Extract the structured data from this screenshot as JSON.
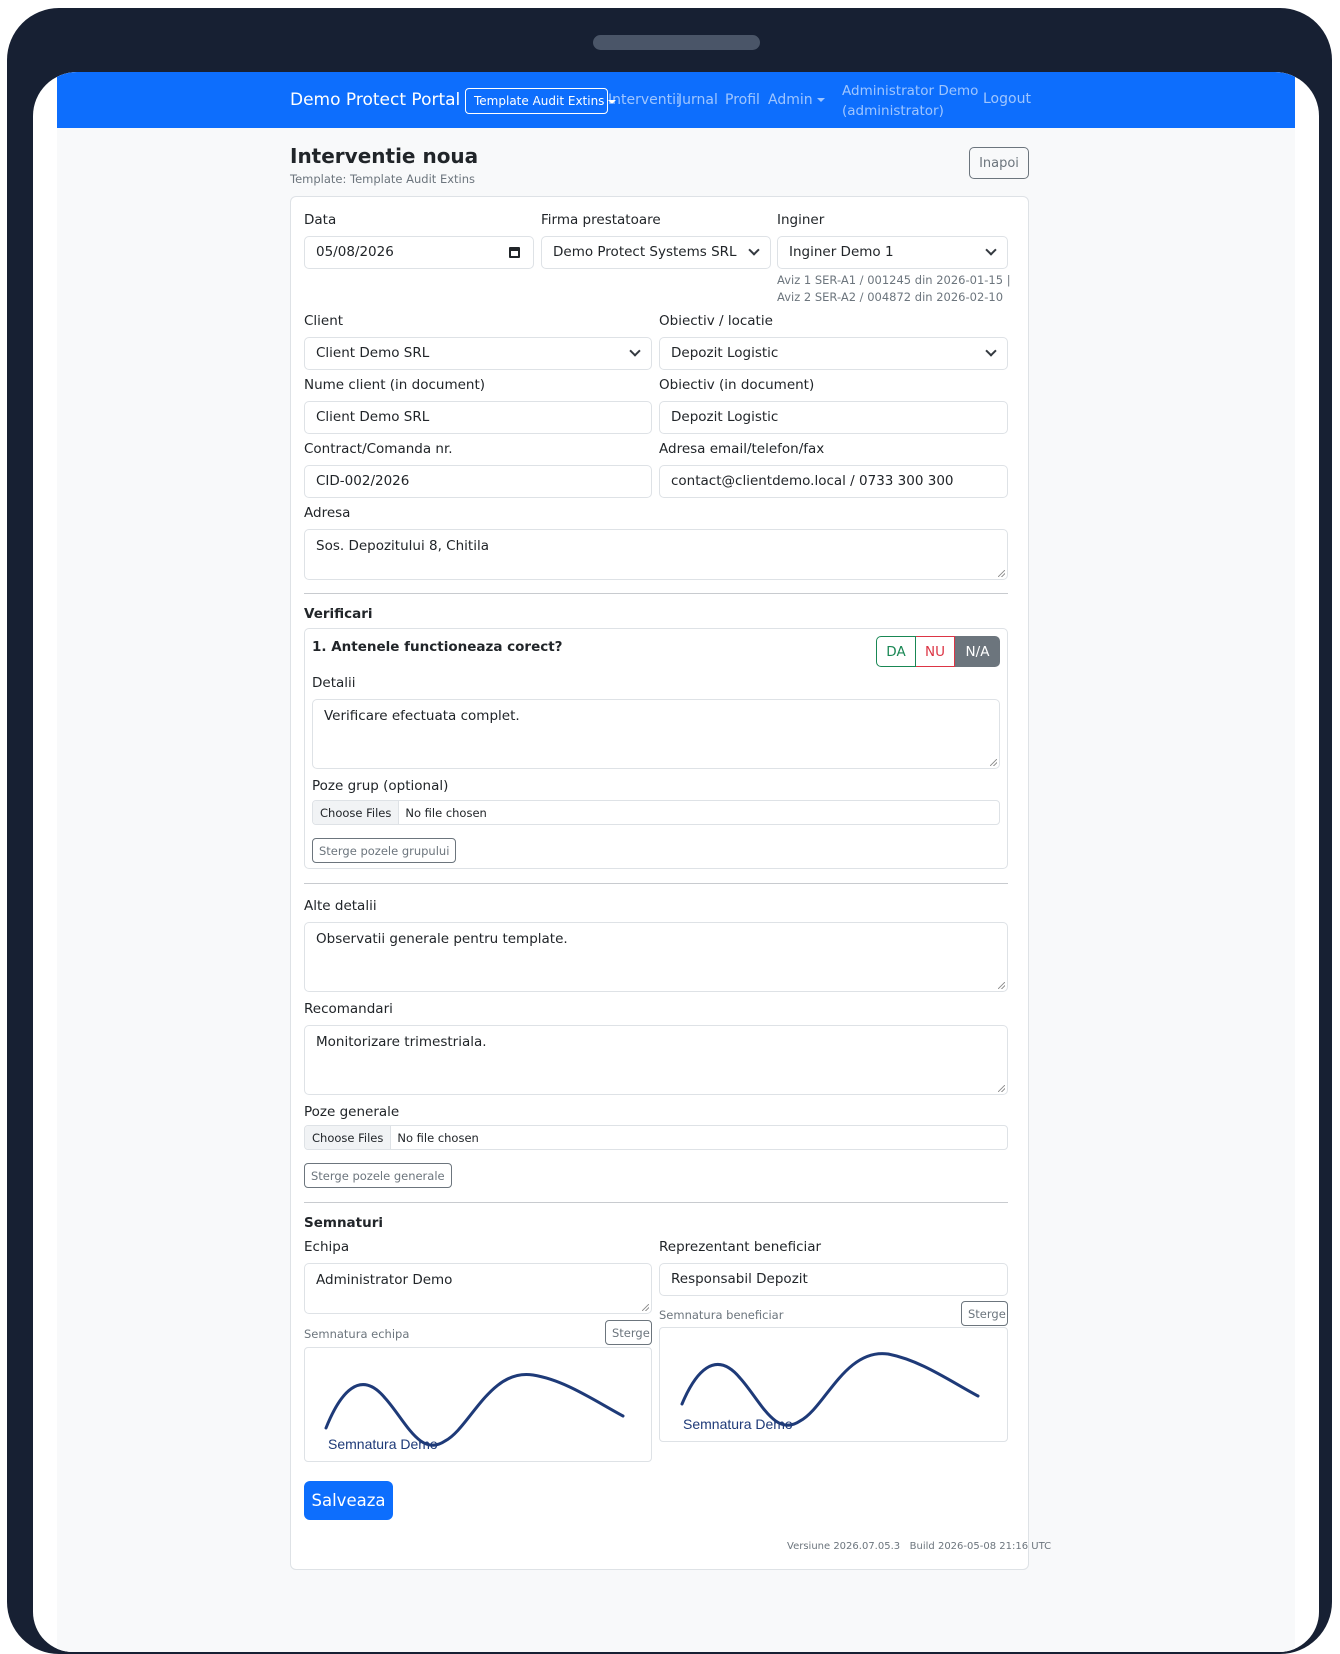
{
  "navbar": {
    "brand": "Demo Protect Portal",
    "template_dropdown": "Template Audit Extins",
    "links": [
      "Interventii",
      "Jurnal",
      "Profil",
      "Admin"
    ],
    "user_name": "Administrator Demo",
    "user_role": "(administrator)",
    "logout": "Logout"
  },
  "header": {
    "title": "Interventie noua",
    "subtitle": "Template: Template Audit Extins",
    "back_button": "Inapoi"
  },
  "form": {
    "data_label": "Data",
    "data_value": "05/08/2026",
    "firma_label": "Firma prestatoare",
    "firma_value": "Demo Protect Systems SRL",
    "inginer_label": "Inginer",
    "inginer_value": "Inginer Demo 1",
    "inginer_hint": "Aviz 1 SER-A1 / 001245 din 2026-01-15 | Aviz 2 SER-A2 / 004872 din 2026-02-10",
    "client_label": "Client",
    "client_value": "Client Demo SRL",
    "obiectiv_label": "Obiectiv / locatie",
    "obiectiv_value": "Depozit Logistic",
    "nume_client_label": "Nume client (in document)",
    "nume_client_value": "Client Demo SRL",
    "obiectiv_doc_label": "Obiectiv (in document)",
    "obiectiv_doc_value": "Depozit Logistic",
    "contract_label": "Contract/Comanda nr.",
    "contract_value": "CID-002/2026",
    "contact_label": "Adresa email/telefon/fax",
    "contact_value": "contact@clientdemo.local / 0733 300 300",
    "adresa_label": "Adresa",
    "adresa_value": "Sos. Depozitului 8, Chitila"
  },
  "verificari": {
    "title": "Verificari",
    "question": "1. Antenele functioneaza corect?",
    "options": [
      "DA",
      "NU",
      "N/A"
    ],
    "selected": "N/A",
    "detalii_label": "Detalii",
    "detalii_value": "Verificare efectuata complet.",
    "poze_label": "Poze grup (optional)",
    "choose_files": "Choose Files",
    "no_file": "No file chosen",
    "sterge_button": "Sterge pozele grupului"
  },
  "alte": {
    "alte_label": "Alte detalii",
    "alte_value": "Observatii generale pentru template.",
    "recomandari_label": "Recomandari",
    "recomandari_value": "Monitorizare trimestriala.",
    "poze_label": "Poze generale",
    "choose_files": "Choose Files",
    "no_file": "No file chosen",
    "sterge_button": "Sterge pozele generale"
  },
  "semnaturi": {
    "title": "Semnaturi",
    "echipa_label": "Echipa",
    "echipa_value": "Administrator Demo",
    "beneficiar_label": "Reprezentant beneficiar",
    "beneficiar_value": "Responsabil Depozit",
    "sig_echipa_label": "Semnatura echipa",
    "sig_beneficiar_label": "Semnatura beneficiar",
    "sterge": "Sterge",
    "sig_echipa_text": "Semnatura Demo",
    "sig_beneficiar_text": "Semnatura Demo",
    "signature_color": "#1e3a78"
  },
  "save_button": "Salveaza",
  "footer": {
    "version": "Versiune 2026.07.05.3",
    "build": "Build 2026-05-08 21:16 UTC"
  },
  "colors": {
    "primary": "#0d6efd",
    "success": "#198754",
    "danger": "#dc3545",
    "secondary": "#6c757d",
    "device_frame": "#172033"
  }
}
